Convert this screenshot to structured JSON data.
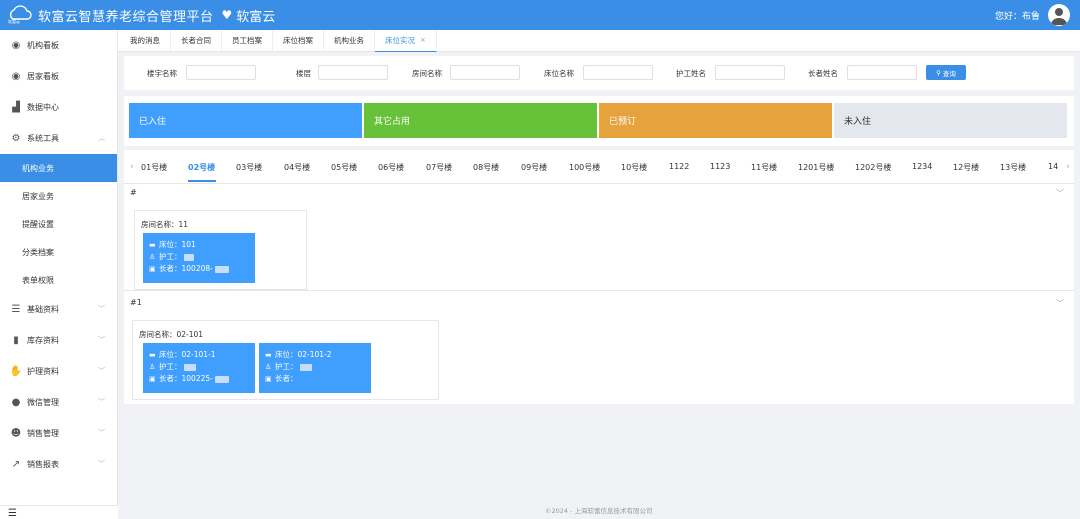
{
  "header": {
    "logo_text": "软富云",
    "title": "软富云智慧养老综合管理平台",
    "heart": "♥",
    "brand": "软富云",
    "greeting": "您好：布鲁"
  },
  "sidebar": {
    "items": [
      {
        "label": "机构看板",
        "icon": "dashboard-icon"
      },
      {
        "label": "居家看板",
        "icon": "dashboard-icon"
      },
      {
        "label": "数据中心",
        "icon": "chart-icon"
      },
      {
        "label": "系统工具",
        "icon": "gear-icon"
      },
      {
        "label": "机构业务",
        "sub": true,
        "active": true
      },
      {
        "label": "居家业务",
        "sub": true
      },
      {
        "label": "提醒设置",
        "sub": true
      },
      {
        "label": "分类档案",
        "sub": true
      },
      {
        "label": "表单权限",
        "sub": true
      },
      {
        "label": "基础资料",
        "icon": "database-icon"
      },
      {
        "label": "库存资料",
        "icon": "bookmark-icon"
      },
      {
        "label": "护理资料",
        "icon": "handshake-icon"
      },
      {
        "label": "微信管理",
        "icon": "wechat-icon"
      },
      {
        "label": "销售管理",
        "icon": "people-icon"
      },
      {
        "label": "销售报表",
        "icon": "line-chart-icon"
      }
    ]
  },
  "tabs": [
    "我的消息",
    "长者合同",
    "员工档案",
    "床位档案",
    "机构业务",
    "床位实况"
  ],
  "tab_close": "×",
  "filters": {
    "building": "楼宇名称",
    "floor": "楼层",
    "room": "房间名称",
    "bed": "床位名称",
    "nurse": "护工姓名",
    "elder": "长者姓名",
    "query": "查询"
  },
  "legend": {
    "occupied": {
      "label": "已入住",
      "color": "#409eff"
    },
    "other": {
      "label": "其它占用",
      "color": "#67c23a"
    },
    "reserved": {
      "label": "已预订",
      "color": "#e6a23c"
    },
    "vacant": {
      "label": "未入住",
      "color": "#e4e7ed"
    }
  },
  "floors": [
    "01号楼",
    "02号楼",
    "03号楼",
    "04号楼",
    "05号楼",
    "06号楼",
    "07号楼",
    "08号楼",
    "09号楼",
    "100号楼",
    "10号楼",
    "1122",
    "1123",
    "11号楼",
    "1201号楼",
    "1202号楼",
    "1234",
    "12号楼",
    "13号楼",
    "14"
  ],
  "sections": [
    {
      "head": "#",
      "rooms": [
        {
          "name": "房间名称：11",
          "beds": [
            {
              "bed": "床位：101",
              "nurse": "护工：",
              "elder": "长者：100208-"
            }
          ]
        }
      ]
    },
    {
      "head": "#1",
      "rooms": [
        {
          "name": "房间名称：02-101",
          "beds": [
            {
              "bed": "床位：02-101-1",
              "nurse": "护工：",
              "elder": "长者：100225-"
            },
            {
              "bed": "床位：02-101-2",
              "nurse": "护工：",
              "elder": "长者："
            }
          ]
        }
      ]
    }
  ],
  "footer": "©2024 - 上海软富信息技术有限公司"
}
